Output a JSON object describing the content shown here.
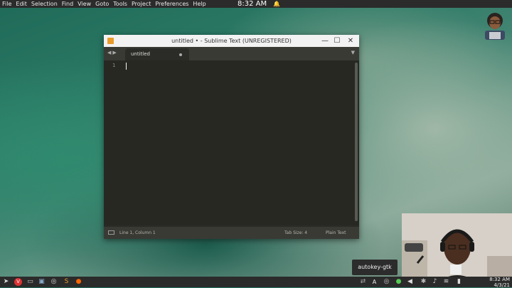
{
  "top_bar": {
    "menu": [
      "File",
      "Edit",
      "Selection",
      "Find",
      "View",
      "Goto",
      "Tools",
      "Project",
      "Preferences",
      "Help"
    ],
    "clock": "8:32 AM"
  },
  "window": {
    "title": "untitled • - Sublime Text (UNREGISTERED)",
    "controls": {
      "minimize": "—",
      "maximize": "☐",
      "close": "✕"
    },
    "tab_label": "untitled",
    "line_number": "1",
    "status": {
      "position": "Line 1, Column 1",
      "tab_size": "Tab Size: 4",
      "syntax": "Plain Text"
    }
  },
  "tooltip": "autokey-gtk",
  "taskbar": {
    "clock_time": "8:32 AM",
    "clock_date": "4/3/21",
    "tray_letter": "A"
  },
  "colors": {
    "app_icon": "#e89b2a",
    "editor_bg": "#272822",
    "titlebar_bg": "#f2f2f2",
    "bar_bg": "#2b2b2b"
  }
}
